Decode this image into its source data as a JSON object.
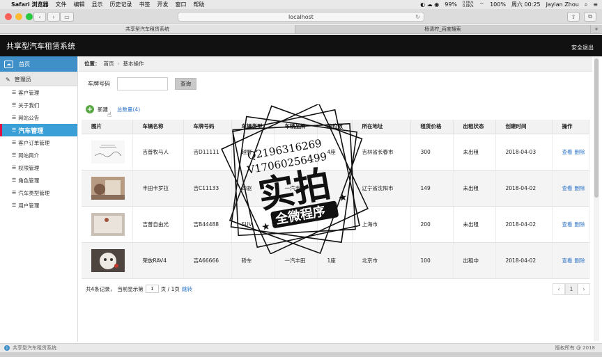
{
  "menubar": {
    "items": [
      "Safari 浏览器",
      "文件",
      "编辑",
      "显示",
      "历史记录",
      "书签",
      "开发",
      "窗口",
      "帮助"
    ],
    "battery": "99%",
    "net_up": "0.0K/s",
    "net_down": "0.0K/s",
    "battery2": "100%",
    "clock": "周六 00:25",
    "user": "Jaylan Zhou"
  },
  "browser": {
    "url": "localhost",
    "tabs": [
      "共享型汽车租赁系统",
      "杨清柠_百度搜索"
    ]
  },
  "app": {
    "title": "共享型汽车租赁系统",
    "logout": "安全退出"
  },
  "sidebar": {
    "home": "首页",
    "admin": "管理员",
    "items": [
      "客户管理",
      "关于我们",
      "网站公告",
      "汽车管理",
      "客户订单管理",
      "网站简介",
      "权限管理",
      "角色管理",
      "汽车类型管理",
      "用户管理"
    ]
  },
  "breadcrumb": {
    "label": "位置：",
    "home": "首页",
    "current": "基本操作"
  },
  "search": {
    "label": "车牌号码",
    "value": "",
    "button": "查询"
  },
  "actions": {
    "new": "新建",
    "total": "总数量(4)"
  },
  "table": {
    "headers": [
      "图片",
      "车辆名称",
      "车牌号码",
      "车辆类型",
      "车辆品牌",
      "座位数",
      "所在地址",
      "租赁价格",
      "出租状态",
      "创建时间",
      "操作"
    ],
    "rows": [
      {
        "name": "吉普牧马人",
        "plate": "吉D11111",
        "type": "越野",
        "brand": "",
        "seats": "4座",
        "address": "吉林省长春市",
        "price": "300",
        "status": "未出租",
        "created": "2018-04-03",
        "view": "查看",
        "del": "删除"
      },
      {
        "name": "丰田卡罗拉",
        "plate": "吉C11133",
        "type": "四驱",
        "brand": "一汽丰田",
        "seats": "",
        "address": "辽宁省沈阳市",
        "price": "149",
        "status": "未出租",
        "created": "2018-04-02",
        "view": "查看",
        "del": "删除"
      },
      {
        "name": "吉普自由光",
        "plate": "吉B44488",
        "type": "SUV",
        "brand": "",
        "seats": "",
        "address": "上海市",
        "price": "200",
        "status": "未出租",
        "created": "2018-04-02",
        "view": "查看",
        "del": "删除"
      },
      {
        "name": "荣放RAV4",
        "plate": "吉A66666",
        "type": "轿车",
        "brand": "一汽丰田",
        "seats": "1座",
        "address": "北京市",
        "price": "100",
        "status": "出租中",
        "created": "2018-04-02",
        "view": "查看",
        "del": "删除"
      }
    ]
  },
  "pager": {
    "records": "共4条记录，",
    "current_label": "当前显示第",
    "page": "1",
    "pages": "页 / 1页",
    "jump": "跳转",
    "page_num": "1"
  },
  "footer": {
    "left": "共享型汽车租赁系统",
    "right": "版权所有 @ 2018"
  },
  "watermark": {
    "qq": "Q2196316269",
    "v": "V17060256499",
    "big": "实拍",
    "banner": "全微程序"
  },
  "colors": {
    "accent": "#3a9fd6",
    "header_bg": "#111111",
    "link": "#2a72c8",
    "new_icon": "#5aa843"
  }
}
